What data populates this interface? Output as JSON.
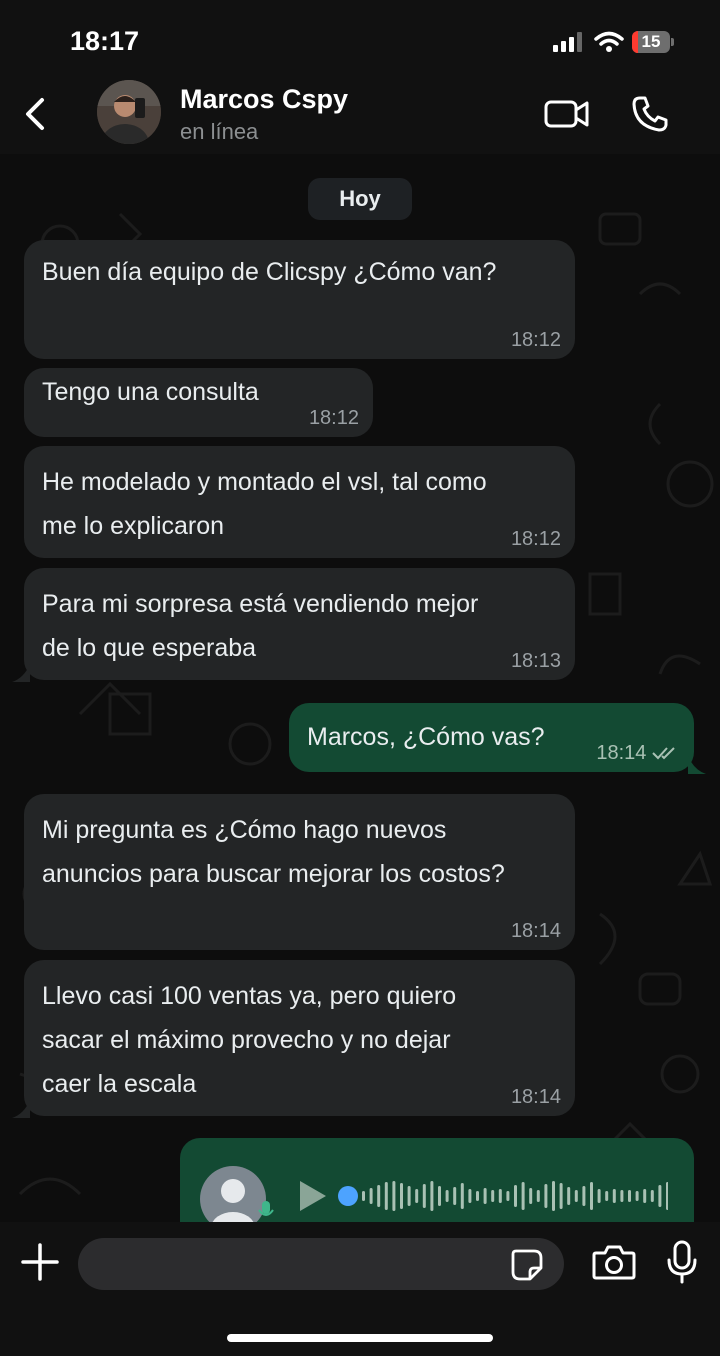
{
  "status_bar": {
    "time": "18:17",
    "battery": "15",
    "battery_level": 0.15
  },
  "header": {
    "contact_name": "Marcos Cspy",
    "presence": "en línea"
  },
  "chat": {
    "day_label": "Hoy",
    "messages": [
      {
        "dir": "in",
        "lines": [
          "Buen día equipo de Clicspy ¿Cómo van?"
        ],
        "time": "18:12"
      },
      {
        "dir": "in",
        "lines": [
          "Tengo una consulta"
        ],
        "time": "18:12"
      },
      {
        "dir": "in",
        "lines": [
          "He modelado y montado el vsl, tal como",
          "me lo explicaron"
        ],
        "time": "18:12"
      },
      {
        "dir": "in",
        "lines": [
          "Para mi sorpresa está vendiendo mejor",
          "de lo que esperaba"
        ],
        "time": "18:13"
      },
      {
        "dir": "out",
        "lines": [
          "Marcos, ¿Cómo vas?"
        ],
        "time": "18:14",
        "status": "read"
      },
      {
        "dir": "in",
        "lines": [
          "Mi pregunta es ¿Cómo hago nuevos",
          "anuncios para buscar mejorar los costos?"
        ],
        "time": "18:14"
      },
      {
        "dir": "in",
        "lines": [
          "Llevo casi 100 ventas ya, pero quiero",
          "sacar el máximo provecho y no dejar",
          "caer la escala"
        ],
        "time": "18:14"
      }
    ],
    "voice_note": {
      "dir": "out",
      "progress": 0
    }
  },
  "composer": {
    "value": ""
  },
  "colors": {
    "incoming_bubble": "#232526",
    "outgoing_bubble": "#134a33",
    "background": "#0d0d0d",
    "read_ticks": "#a9c1b4"
  },
  "icons": [
    "back-icon",
    "video-call-icon",
    "voice-call-icon",
    "plus-icon",
    "sticker-icon",
    "camera-icon",
    "microphone-icon",
    "play-icon",
    "double-check-icon",
    "signal-icon",
    "wifi-icon",
    "battery-icon"
  ]
}
